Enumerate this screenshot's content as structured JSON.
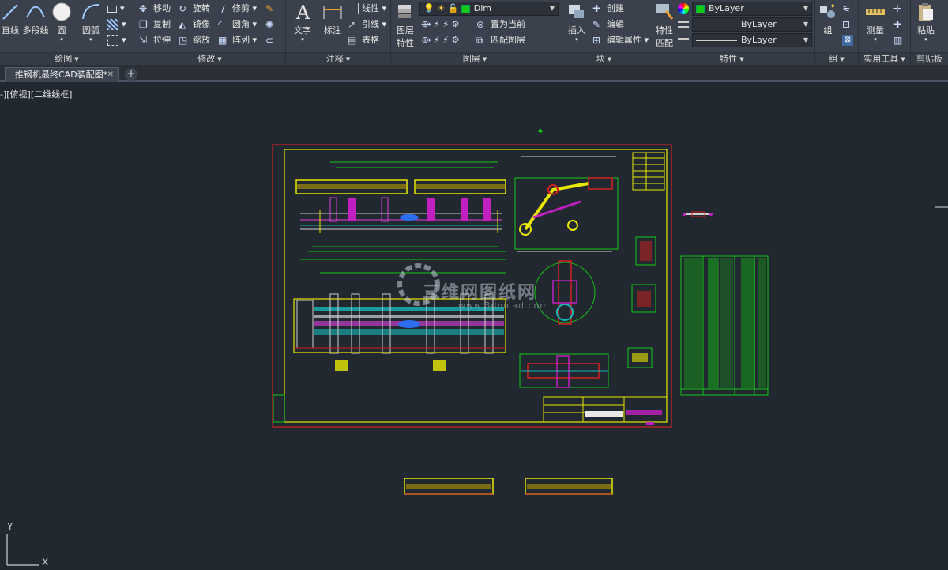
{
  "ribbon": {
    "draw": {
      "title": "绘图",
      "line": "直线",
      "polyline": "多段线",
      "circle": "圆",
      "arc": "圆弧"
    },
    "modify": {
      "title": "修改",
      "move": "移动",
      "rotate": "旋转",
      "trim": "修剪",
      "copy": "复制",
      "mirror": "镜像",
      "fillet": "圆角",
      "stretch": "拉伸",
      "scale": "缩放",
      "array": "阵列"
    },
    "annotation": {
      "title": "注释",
      "text": "文字",
      "dimension": "标注",
      "linear": "线性",
      "leader": "引线",
      "table": "表格"
    },
    "layers": {
      "title": "图层",
      "layer_properties_line1": "图层",
      "layer_properties_line2": "特性",
      "current_layer": "Dim",
      "set_current": "置为当前",
      "match_layer": "匹配图层"
    },
    "block": {
      "title": "块",
      "insert": "插入",
      "create": "创建",
      "edit": "编辑",
      "edit_attributes": "编辑属性"
    },
    "properties": {
      "title": "特性",
      "match_line1": "特性",
      "match_line2": "匹配",
      "color": "ByLayer",
      "linetype": "ByLayer",
      "lineweight": "ByLayer"
    },
    "groups": {
      "title": "组",
      "group": "组"
    },
    "utilities": {
      "title": "实用工具",
      "measure": "测量"
    },
    "clipboard": {
      "title": "剪贴板",
      "paste": "粘贴"
    }
  },
  "tabs": {
    "document": "推钢机最终CAD装配图*",
    "new_tab": "+"
  },
  "viewport_label": "-][俯视][二维线框]",
  "watermark": {
    "text": "三维网图纸网",
    "url": "www.3dmcad.com"
  },
  "ucs": {
    "x": "X",
    "y": "Y"
  },
  "colors": {
    "background": "#212830",
    "ribbon": "#3b414c",
    "layer_green": "#15c915",
    "border_red": "#d42020",
    "frame_yellow": "#e8e800"
  }
}
